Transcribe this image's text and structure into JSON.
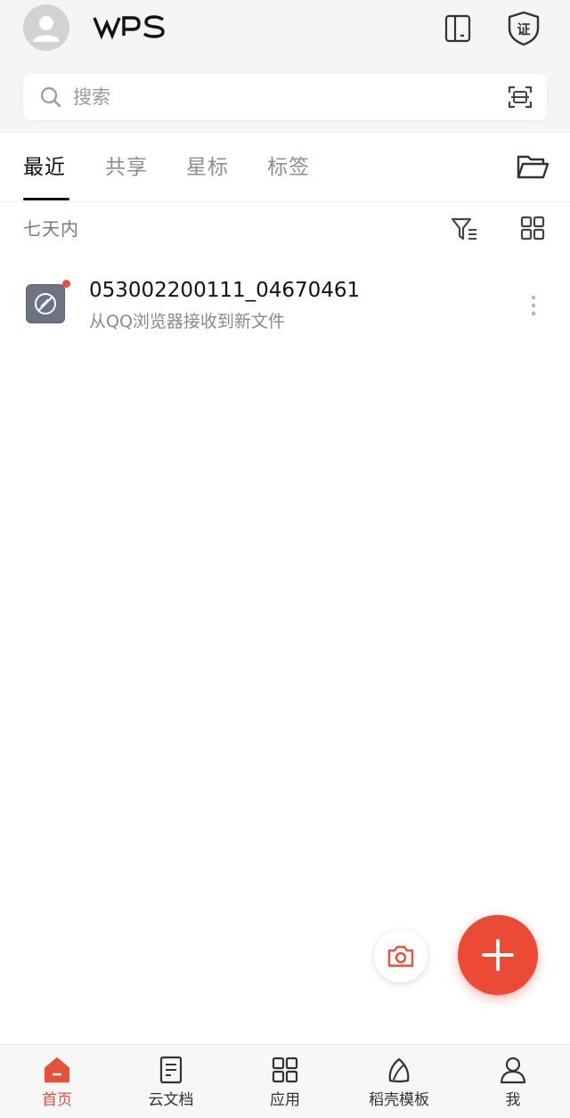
{
  "header": {
    "logo_text": "WPS",
    "icons": [
      "avatar-icon",
      "tablet-mode-icon",
      "certificate-shield-icon"
    ]
  },
  "search": {
    "placeholder": "搜索"
  },
  "tabs": [
    {
      "label": "最近",
      "active": true
    },
    {
      "label": "共享",
      "active": false
    },
    {
      "label": "星标",
      "active": false
    },
    {
      "label": "标签",
      "active": false
    }
  ],
  "section": {
    "label": "七天内"
  },
  "files": [
    {
      "name": "053002200111_04670461",
      "subtitle": "从QQ浏览器接收到新文件",
      "unread": true
    }
  ],
  "nav": [
    {
      "label": "首页",
      "icon": "home-icon",
      "active": true
    },
    {
      "label": "云文档",
      "icon": "cloud-doc-icon",
      "active": false
    },
    {
      "label": "应用",
      "icon": "apps-grid-icon",
      "active": false
    },
    {
      "label": "稻壳模板",
      "icon": "leaf-icon",
      "active": false
    },
    {
      "label": "我",
      "icon": "user-icon",
      "active": false
    }
  ],
  "colors": {
    "accent": "#eb4b36",
    "header_bg": "#f5f5f5"
  }
}
